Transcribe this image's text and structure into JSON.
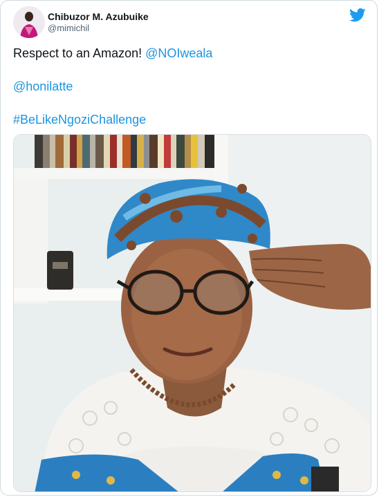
{
  "user": {
    "display_name": "Chibuzor M. Azubuike",
    "handle": "@mimichil"
  },
  "tweet": {
    "line1_text": "Respect to an Amazon! ",
    "line1_mention": "@NOIweala",
    "line2_mention": "@honilatte",
    "line3_hashtag": "#BeLikeNgoziChallenge"
  },
  "icons": {
    "brand": "twitter-bird-icon",
    "avatar": "avatar"
  },
  "colors": {
    "link": "#1b95e0",
    "twitter_blue": "#1d9bf0",
    "text": "#0f1419",
    "secondary": "#536471",
    "border": "#cfd9de"
  }
}
